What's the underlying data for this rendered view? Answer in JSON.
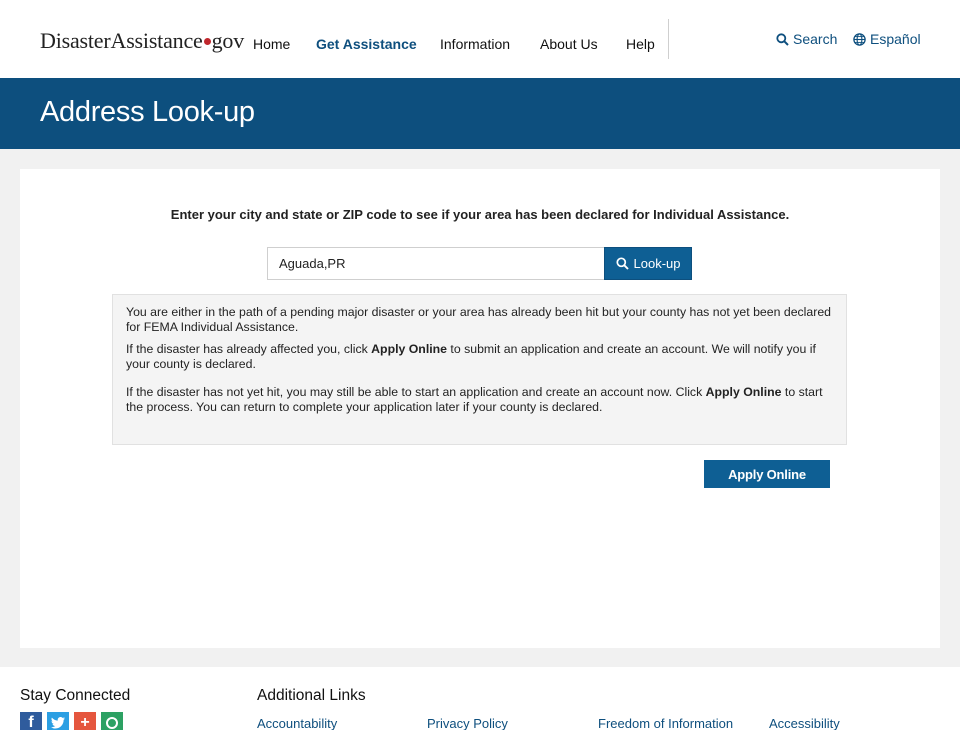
{
  "header": {
    "logo_text_1": "Disaster",
    "logo_text_2": "Assistance",
    "logo_text_3": "gov",
    "nav": [
      "Home",
      "Get Assistance",
      "Information",
      "About Us",
      "Help"
    ],
    "active_nav": "Get Assistance",
    "search_label": "Search",
    "language_label": "Español"
  },
  "banner": {
    "title": "Address Look-up"
  },
  "main": {
    "instruction": "Enter your city and state or ZIP code to see if your area has been declared for Individual Assistance.",
    "input_value": "Aguada,PR",
    "lookup_label": "Look-up",
    "notice": {
      "p1": "You are either in the path of a pending major disaster or your area has already been hit but your county has not yet been declared for FEMA Individual Assistance.",
      "p2_a": "If the disaster has already affected you, click ",
      "p2_b": "Apply Online",
      "p2_c": " to submit an application and create an account. We will notify you if your county is declared.",
      "p3_a": "If the disaster has not yet hit, you may still be able to start an application and create an account now. Click ",
      "p3_b": "Apply Online",
      "p3_c": " to start the process. You can return to complete your application later if your county is declared."
    },
    "apply_label": "Apply Online"
  },
  "footer": {
    "stay_connected": "Stay Connected",
    "social_icons": [
      "facebook-icon",
      "twitter-icon",
      "google-plus-icon",
      "rss-icon"
    ],
    "additional_links_title": "Additional Links",
    "links": [
      "Accountability",
      "Privacy Policy",
      "Freedom of Information",
      "Accessibility"
    ]
  },
  "colors": {
    "brand_blue": "#0d4f7e",
    "button_blue": "#0e5f94",
    "logo_dot": "#c0272d"
  }
}
